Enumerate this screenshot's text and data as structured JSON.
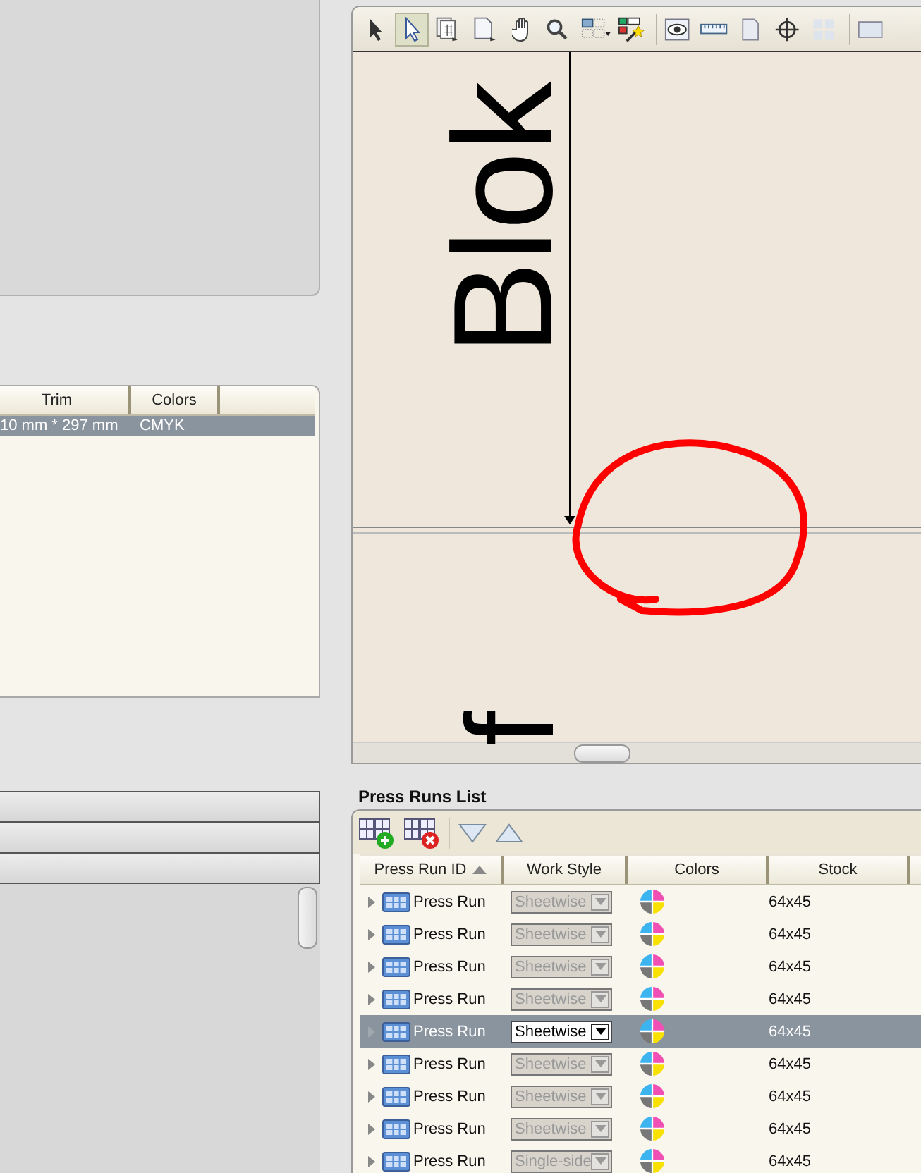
{
  "tools": [
    {
      "kind": "arrow",
      "selected": false
    },
    {
      "kind": "select",
      "selected": true
    },
    {
      "kind": "pages",
      "selected": false
    },
    {
      "kind": "page",
      "selected": false
    },
    {
      "kind": "hand",
      "selected": false
    },
    {
      "kind": "zoom",
      "selected": false
    },
    {
      "kind": "layout",
      "selected": false
    },
    {
      "kind": "wizard",
      "selected": false
    },
    {
      "kind": "eye",
      "selected": false
    },
    {
      "kind": "ruler",
      "selected": false
    },
    {
      "kind": "sheet",
      "selected": false
    },
    {
      "kind": "crosshair",
      "selected": false
    },
    {
      "kind": "split",
      "selected": false
    },
    {
      "kind": "panel",
      "selected": false
    }
  ],
  "canvas": {
    "texts": [
      "Blok",
      "f"
    ]
  },
  "job_table": {
    "columns": [
      "Trim",
      "Colors"
    ],
    "rows": [
      {
        "cells": [
          "10 mm * 297 mm",
          "CMYK"
        ],
        "selected": true
      }
    ]
  },
  "press_runs": {
    "title": "Press Runs List",
    "columns": [
      {
        "label": "Press Run ID",
        "sorted": true
      },
      {
        "label": "Work Style",
        "sorted": false
      },
      {
        "label": "Colors",
        "sorted": false
      },
      {
        "label": "Stock",
        "sorted": false
      }
    ],
    "rows": [
      {
        "id": "Press Run",
        "work_style": "Sheetwise",
        "stock": "64x45",
        "selected": false
      },
      {
        "id": "Press Run",
        "work_style": "Sheetwise",
        "stock": "64x45",
        "selected": false
      },
      {
        "id": "Press Run",
        "work_style": "Sheetwise",
        "stock": "64x45",
        "selected": false
      },
      {
        "id": "Press Run",
        "work_style": "Sheetwise",
        "stock": "64x45",
        "selected": false
      },
      {
        "id": "Press Run",
        "work_style": "Sheetwise",
        "stock": "64x45",
        "selected": true
      },
      {
        "id": "Press Run",
        "work_style": "Sheetwise",
        "stock": "64x45",
        "selected": false
      },
      {
        "id": "Press Run",
        "work_style": "Sheetwise",
        "stock": "64x45",
        "selected": false
      },
      {
        "id": "Press Run",
        "work_style": "Sheetwise",
        "stock": "64x45",
        "selected": false
      },
      {
        "id": "Press Run",
        "work_style": "Single-side",
        "stock": "64x45",
        "selected": false
      }
    ]
  }
}
